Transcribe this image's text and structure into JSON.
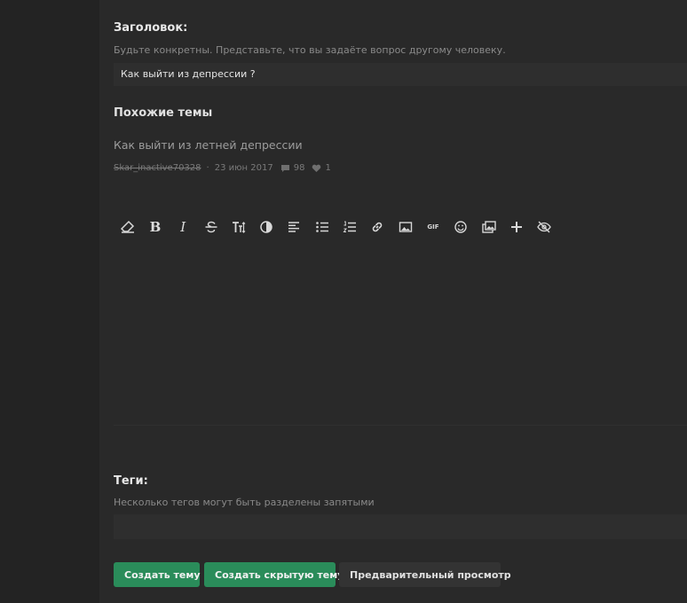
{
  "title_field": {
    "label": "Заголовок:",
    "hint": "Будьте конкретны. Представьте, что вы задаёте вопрос другому человеку.",
    "value": "Как выйти из депрессии ?"
  },
  "similar": {
    "heading": "Похожие темы",
    "items": [
      {
        "title": "Как выйти из летней депрессии",
        "author": "Skar_inactive70328",
        "date": "23 июн 2017",
        "replies": "98",
        "likes": "1"
      }
    ]
  },
  "toolbar": {
    "buttons": [
      {
        "icon": "eraser-icon"
      },
      {
        "icon": "bold-icon",
        "text": "B"
      },
      {
        "icon": "italic-icon",
        "text": "I"
      },
      {
        "icon": "strikethrough-icon"
      },
      {
        "icon": "text-size-icon"
      },
      {
        "icon": "contrast-icon"
      },
      {
        "icon": "align-left-icon"
      },
      {
        "icon": "bullet-list-icon"
      },
      {
        "icon": "numbered-list-icon"
      },
      {
        "icon": "link-icon"
      },
      {
        "icon": "image-icon"
      },
      {
        "icon": "gif-icon",
        "text": "GIF"
      },
      {
        "icon": "emoji-icon"
      },
      {
        "icon": "media-icon"
      },
      {
        "icon": "plus-icon"
      },
      {
        "icon": "hidden-eye-icon"
      }
    ]
  },
  "tags_field": {
    "label": "Теги:",
    "hint": "Несколько тегов могут быть разделены запятыми"
  },
  "actions": {
    "create": "Создать тему",
    "create_hidden": "Создать скрытую тему",
    "preview": "Предварительный просмотр"
  },
  "colors": {
    "background": "#232323",
    "panel": "#292929",
    "accent_green": "#2a8c5a"
  }
}
